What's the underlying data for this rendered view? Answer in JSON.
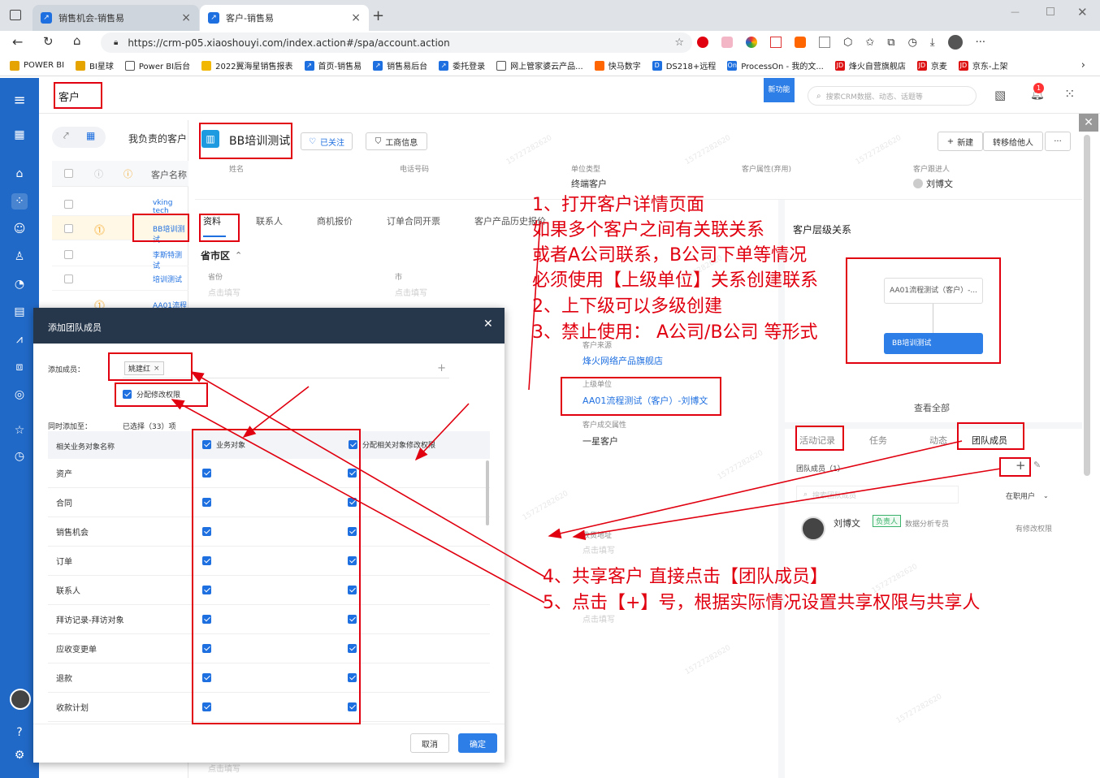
{
  "browser": {
    "tabs": [
      {
        "label": "销售机会-销售易",
        "active": false
      },
      {
        "label": "客户-销售易",
        "active": true
      }
    ],
    "url": "https://crm-p05.xiaoshouyi.com/index.action#/spa/account.action",
    "bookmarks": [
      "POWER BI",
      "BI星球",
      "Power BI后台",
      "2022翼海星销售报表",
      "首页-销售易",
      "销售易后台",
      "委托登录",
      "网上管家婆云产品...",
      "快马数字",
      "DS218+远程",
      "ProcessOn - 我的文...",
      "烽火自营旗舰店",
      "京麦",
      "京东-上架"
    ]
  },
  "app": {
    "module_title": "客户",
    "new_feature_badge": "新功能",
    "search_placeholder": "搜索CRM数据、动态、话题等",
    "notification_count": "1"
  },
  "list": {
    "tab_label": "我负责的客户",
    "column_header": "客户名称",
    "rows": [
      "vking tech",
      "BB培训测试",
      "李斯特测试",
      "培训测试",
      "AA01流程"
    ]
  },
  "detail": {
    "title": "BB培训测试",
    "follow_label": "已关注",
    "business_info_label": "工商信息",
    "new_label": "新建",
    "transfer_label": "转移给他人",
    "more_label": "···",
    "fields": [
      {
        "label": "姓名",
        "value": ""
      },
      {
        "label": "电话号码",
        "value": ""
      },
      {
        "label": "单位类型",
        "value": "终端客户"
      },
      {
        "label": "客户属性(弃用)",
        "value": ""
      },
      {
        "label": "客户跟进人",
        "value": "刘博文"
      }
    ],
    "tabs": [
      "资料",
      "联系人",
      "商机报价",
      "订单合同开票",
      "客户产品历史报价"
    ],
    "section_title": "省市区",
    "province_label": "省份",
    "city_label": "市",
    "placeholder": "点击填写",
    "source_label": "客户来源",
    "source_value": "烽火网络产品旗舰店",
    "parent_label": "上级单位",
    "parent_value": "AA01流程测试（客户）-刘博文",
    "deal_label": "客户成交属性",
    "deal_value": "一星客户",
    "shipping_label": "收货地址",
    "bottom_placeholder": "点击填写",
    "hierarchy_title": "客户层级关系",
    "hierarchy_parent": "AA01流程测试（客户）-...",
    "hierarchy_child": "BB培训测试",
    "view_all": "查看全部",
    "right_tabs": [
      "活动记录",
      "任务",
      "动态",
      "团队成员"
    ],
    "team_count_label": "团队成员（1）",
    "team_search_placeholder": "搜索团队成员",
    "filter_label": "在职用户",
    "member_name": "刘博文",
    "member_role_badge": "负责人",
    "member_title": "数据分析专员",
    "member_permission": "有修改权限"
  },
  "dialog": {
    "title": "添加团队成员",
    "add_member_label": "添加成员：",
    "member_tag": "姚建红",
    "assign_edit_label": "分配修改权限",
    "also_add_label": "同时添加至：",
    "selected_count": "已选择（33）项",
    "col_name": "相关业务对象名称",
    "col_object": "业务对象",
    "col_permission": "分配相关对象修改权限",
    "rows": [
      "资产",
      "合同",
      "销售机会",
      "订单",
      "联系人",
      "拜访记录-拜访对象",
      "应收变更单",
      "退款",
      "收款计划"
    ],
    "cancel_label": "取消",
    "confirm_label": "确定"
  },
  "annotations": {
    "lines": [
      "1、打开客户详情页面",
      "如果多个客户之间有关联关系",
      "或者A公司联系，B公司下单等情况",
      "必须使用【上级单位】关系创建联系",
      "2、上下级可以多级创建",
      "3、禁止使用： A公司/B公司 等形式"
    ],
    "step4": "4、共享客户    直接点击【团队成员】",
    "step5": "5、点击【+】号，根据实际情况设置共享权限与共享人"
  },
  "colors": {
    "accent": "#1e6fe0",
    "nav": "#2169c7",
    "annotation": "#e0000f",
    "dialog_header": "#26374c"
  }
}
